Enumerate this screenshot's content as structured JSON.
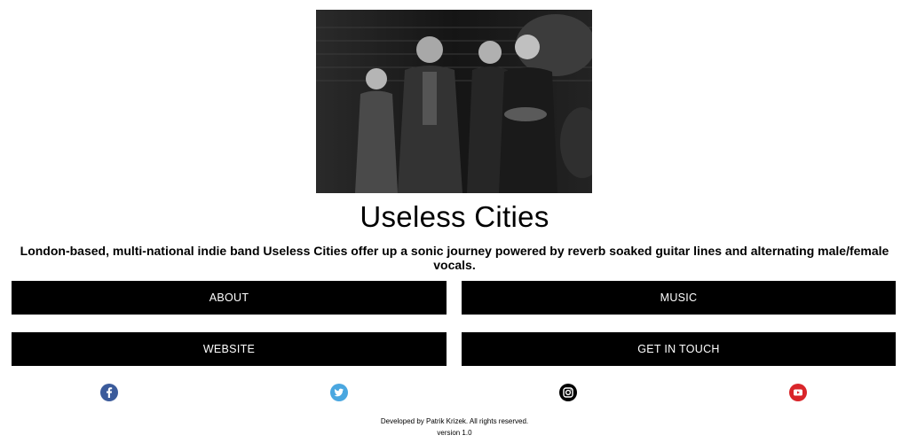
{
  "header": {
    "band_name": "Useless Cities",
    "tagline": "London-based, multi-national indie band Useless Cities offer up a sonic journey powered by reverb soaked guitar lines and alternating male/female vocals."
  },
  "nav": {
    "about_label": "ABOUT",
    "music_label": "MUSIC",
    "website_label": "WEBSITE",
    "contact_label": "GET IN TOUCH"
  },
  "social": [
    {
      "icon": "facebook-icon",
      "color": "#3b5b9b"
    },
    {
      "icon": "twitter-icon",
      "color": "#4aa7e0"
    },
    {
      "icon": "instagram-icon",
      "color": "#000000"
    },
    {
      "icon": "youtube-icon",
      "color": "#d9252a"
    }
  ],
  "footer": {
    "credits": "Developed by Patrik Krizek. All rights reserved.",
    "version": "version 1.0"
  }
}
